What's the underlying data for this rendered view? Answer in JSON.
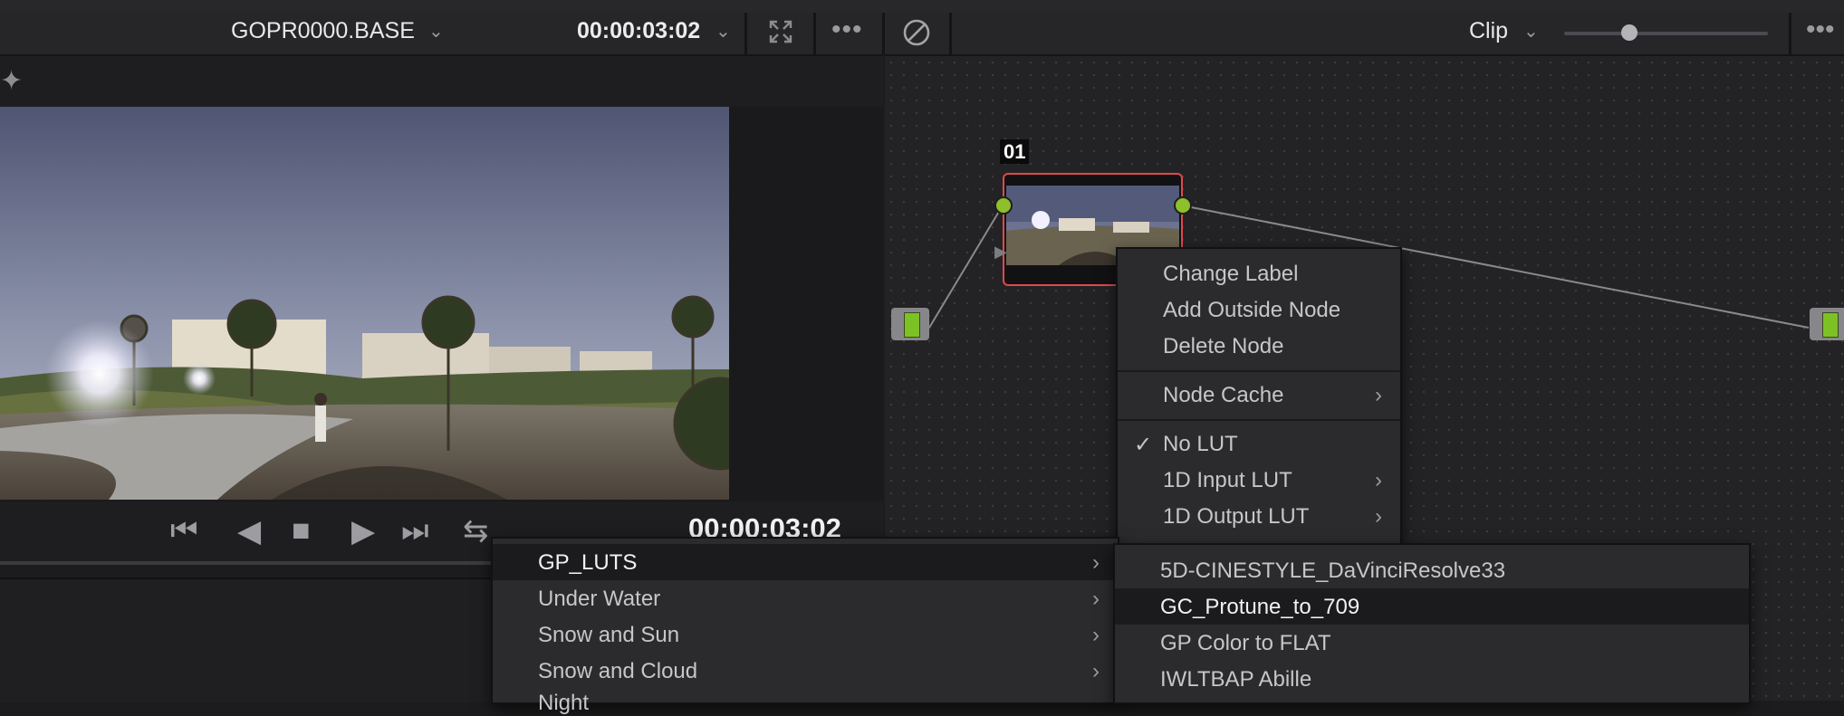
{
  "viewer": {
    "clip_name": "GOPR0000.BASE",
    "timecode": "00:00:03:02",
    "playback_timecode": "00:00:03:02"
  },
  "node_editor": {
    "mode": "Clip",
    "node_label": "01"
  },
  "node_menu": {
    "items": [
      "Change Label",
      "Add Outside Node",
      "Delete Node",
      "Node Cache",
      "No LUT",
      "1D Input LUT",
      "1D Output LUT"
    ],
    "checked": "No LUT"
  },
  "lut_categories": {
    "items": [
      "GP_LUTS",
      "Under Water",
      "Snow and Sun",
      "Snow and Cloud",
      "Night"
    ],
    "selected": "GP_LUTS"
  },
  "lut_files": {
    "items": [
      "5D-CINESTYLE_DaVinciResolve33",
      "GC_Protune_to_709",
      "GP Color to FLAT",
      "IWLTBAP Abille"
    ],
    "highlighted": "GC_Protune_to_709"
  },
  "colors": {
    "accent_green": "#8dc02a",
    "node_border": "#e3484b",
    "menu_bg": "#2b2b2e"
  }
}
